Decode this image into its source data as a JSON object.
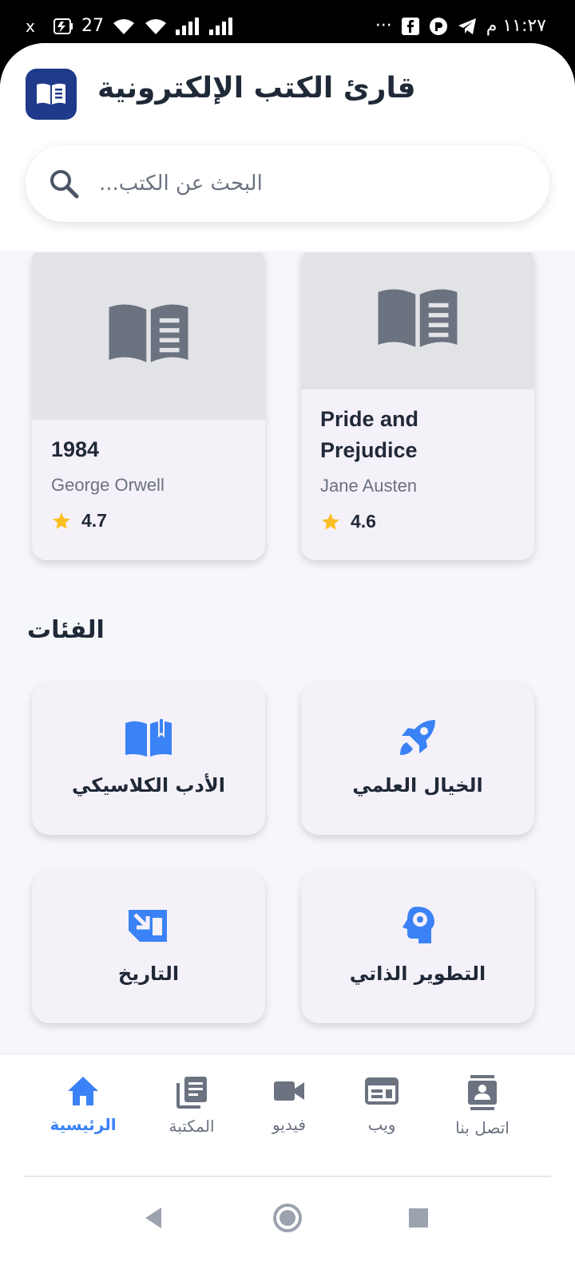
{
  "status_bar": {
    "time": "١١:٢٧ م",
    "battery_level": "27",
    "more_icon": "more-dots-icon",
    "icons": [
      "facebook-icon",
      "messenger-icon",
      "telegram-icon",
      "wifi-icon",
      "signal-icon",
      "battery-icon"
    ]
  },
  "header": {
    "title": "قارئ الكتب الإلكترونية",
    "logo_icon": "book-open-icon",
    "brand_color": "#1f3a8a"
  },
  "search": {
    "placeholder": "البحث عن الكتب..."
  },
  "books": [
    {
      "title": "1984",
      "author": "George Orwell",
      "rating": "4.7"
    },
    {
      "title": "Pride and Prejudice",
      "author": "Jane Austen",
      "rating": "4.6"
    }
  ],
  "categories_section": {
    "title": "الفئات",
    "items": [
      {
        "label": "الأدب الكلاسيكي",
        "icon": "book-icon"
      },
      {
        "label": "الخيال العلمي",
        "icon": "rocket-icon"
      },
      {
        "label": "التاريخ",
        "icon": "history-icon"
      },
      {
        "label": "التطوير الذاتي",
        "icon": "head-gear-icon"
      }
    ],
    "accent_color": "#3b82f6"
  },
  "bottom_nav": {
    "items": [
      {
        "label": "الرئيسية",
        "icon": "home-icon",
        "active": true
      },
      {
        "label": "المكتبة",
        "icon": "library-icon",
        "active": false
      },
      {
        "label": "فيديو",
        "icon": "video-icon",
        "active": false
      },
      {
        "label": "ويب",
        "icon": "web-icon",
        "active": false
      },
      {
        "label": "اتصل بنا",
        "icon": "contact-icon",
        "active": false
      }
    ]
  },
  "system_nav": [
    "back-icon",
    "home-circle-icon",
    "recents-icon"
  ]
}
